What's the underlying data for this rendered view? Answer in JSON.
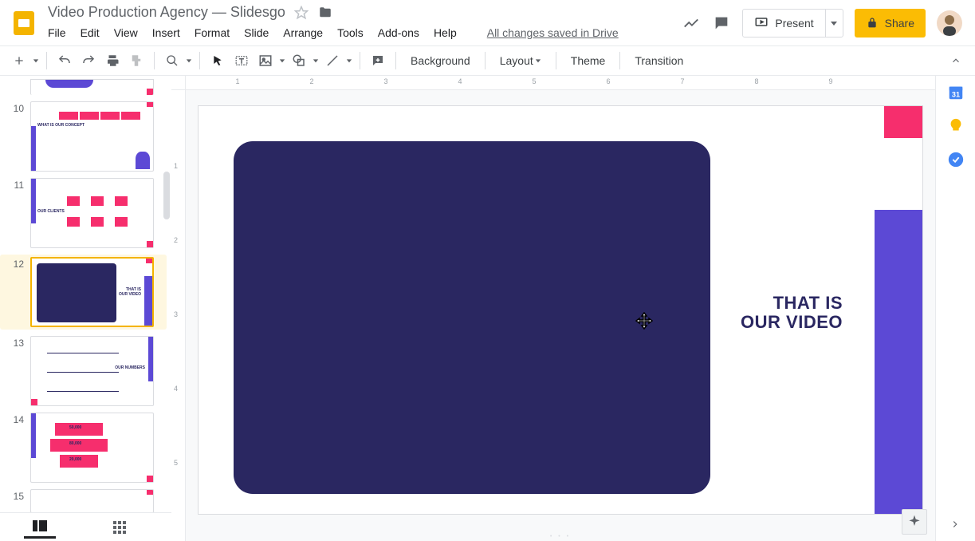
{
  "header": {
    "title": "Video Production Agency — Slidesgo",
    "saved_status": "All changes saved in Drive",
    "menus": {
      "file": "File",
      "edit": "Edit",
      "view": "View",
      "insert": "Insert",
      "format": "Format",
      "slide": "Slide",
      "arrange": "Arrange",
      "tools": "Tools",
      "addons": "Add-ons",
      "help": "Help"
    },
    "present_label": "Present",
    "share_label": "Share"
  },
  "toolbar": {
    "background": "Background",
    "layout": "Layout",
    "theme": "Theme",
    "transition": "Transition"
  },
  "ruler_h": [
    "1",
    "2",
    "3",
    "4",
    "5",
    "6",
    "7",
    "8",
    "9"
  ],
  "ruler_v": [
    "1",
    "2",
    "3",
    "4",
    "5"
  ],
  "filmstrip": {
    "items": [
      {
        "number": "10"
      },
      {
        "number": "11"
      },
      {
        "number": "12",
        "selected": true
      },
      {
        "number": "13"
      },
      {
        "number": "14"
      },
      {
        "number": "15"
      }
    ]
  },
  "slide": {
    "title_line1": "THAT IS",
    "title_line2": "OUR VIDEO"
  },
  "thumbs": {
    "t12_line1": "THAT IS",
    "t12_line2": "OUR VIDEO",
    "t10_heading": "WHAT IS OUR CONCEPT",
    "t11_heading": "OUR CLIENTS",
    "t13_heading": "OUR NUMBERS",
    "t14_a": "50,000",
    "t14_b": "80,000",
    "t14_c": "20,000"
  }
}
